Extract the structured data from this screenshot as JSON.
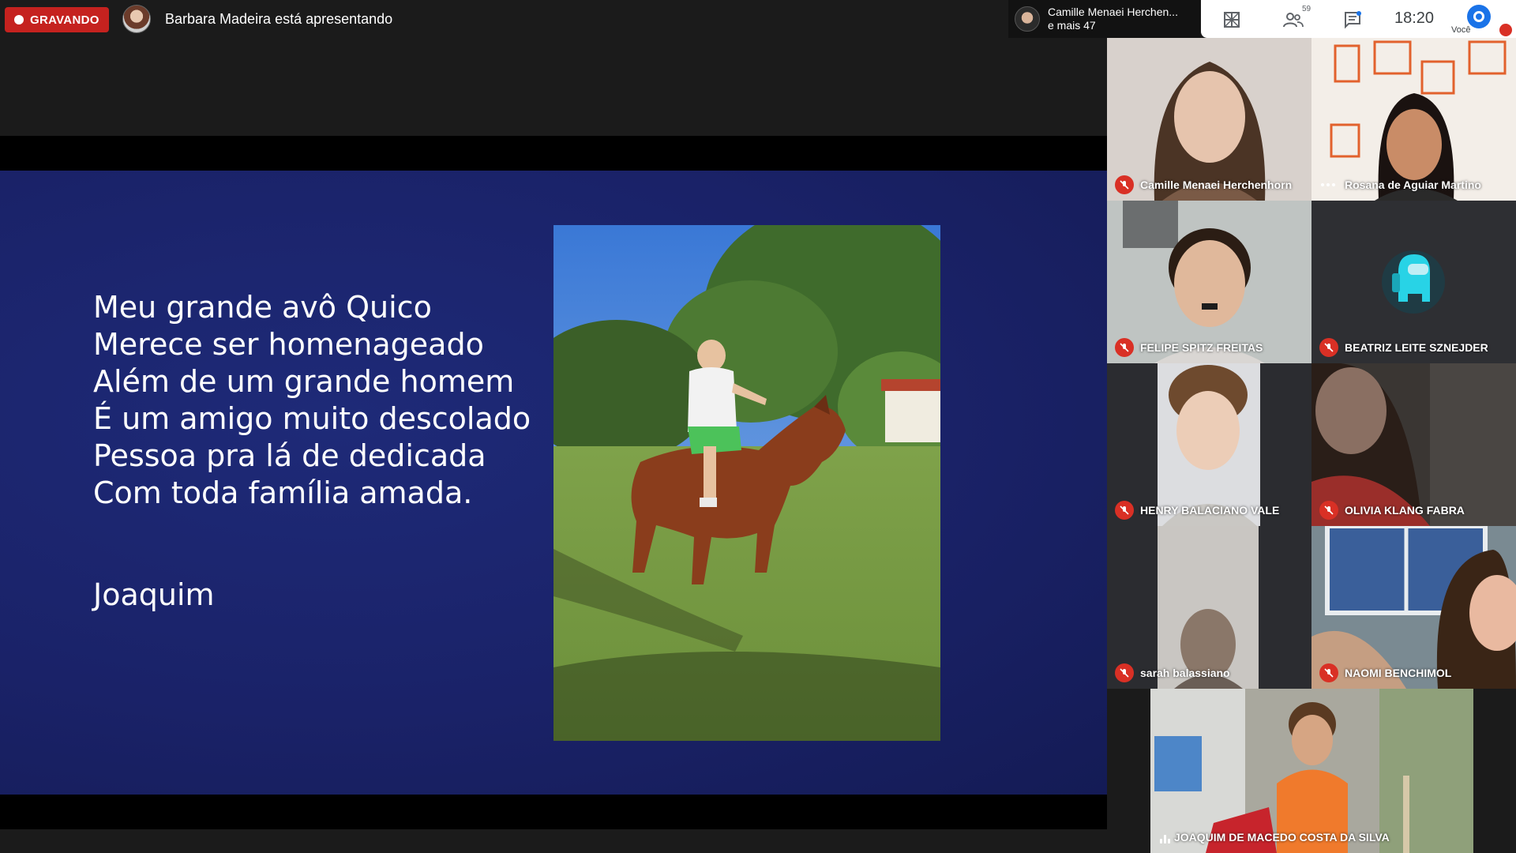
{
  "recording": {
    "label": "GRAVANDO"
  },
  "presenter": {
    "text": "Barbara Madeira está apresentando"
  },
  "pip": {
    "name": "Camille Menaei Herchen...",
    "more": "e mais 47"
  },
  "toolbar": {
    "participants_count": "59",
    "clock": "18:20",
    "self_label": "Você"
  },
  "slide": {
    "poem_lines": [
      "Meu grande avô Quico",
      "Merece ser homenageado",
      "Além de um grande homem",
      "É um amigo muito descolado",
      "Pessoa pra lá de dedicada",
      "Com toda família amada."
    ],
    "author": "Joaquim"
  },
  "participants": [
    {
      "name": "Camille Menaei Herchenhorn",
      "status": "muted"
    },
    {
      "name": "Rosana de Aguiar Martino",
      "status": "more"
    },
    {
      "name": "FELIPE SPITZ FREITAS",
      "status": "muted"
    },
    {
      "name": "BEATRIZ LEITE SZNEJDER",
      "status": "muted"
    },
    {
      "name": "HENRY BALACIANO VALE",
      "status": "muted"
    },
    {
      "name": "OLIVIA KLANG FABRA",
      "status": "muted"
    },
    {
      "name": "sarah balassiano",
      "status": "muted"
    },
    {
      "name": "NAOMI BENCHIMOL",
      "status": "muted"
    },
    {
      "name": "JOAQUIM DE MACEDO COSTA DA SILVA",
      "status": "speaking"
    }
  ],
  "colors": {
    "recording": "#c5221f",
    "slide_bg": "#1a2268",
    "mute": "#d93025",
    "self_avatar": "#1a73e8"
  }
}
